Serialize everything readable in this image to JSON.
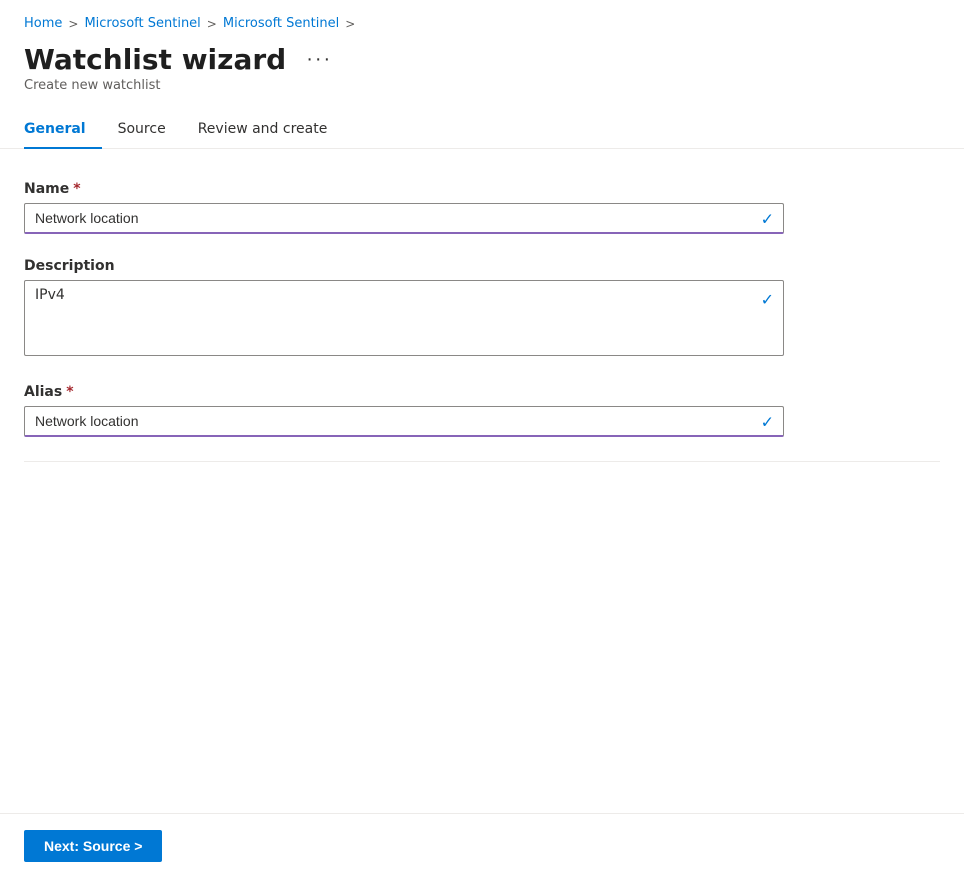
{
  "breadcrumb": {
    "items": [
      {
        "label": "Home",
        "href": "#"
      },
      {
        "label": "Microsoft Sentinel",
        "href": "#"
      },
      {
        "label": "Microsoft Sentinel",
        "href": "#"
      }
    ],
    "separators": [
      ">",
      ">",
      ">"
    ]
  },
  "header": {
    "title": "Watchlist wizard",
    "more_label": "···",
    "subtitle": "Create new watchlist"
  },
  "tabs": [
    {
      "label": "General",
      "active": true
    },
    {
      "label": "Source",
      "active": false
    },
    {
      "label": "Review and create",
      "active": false
    }
  ],
  "form": {
    "name_label": "Name",
    "name_required": "*",
    "name_value": "Network location",
    "name_checkmark": "✓",
    "description_label": "Description",
    "description_value": "IPv4",
    "description_checkmark": "✓",
    "alias_label": "Alias",
    "alias_required": "*",
    "alias_value": "Network location",
    "alias_checkmark": "✓"
  },
  "footer": {
    "next_button_label": "Next: Source >"
  }
}
